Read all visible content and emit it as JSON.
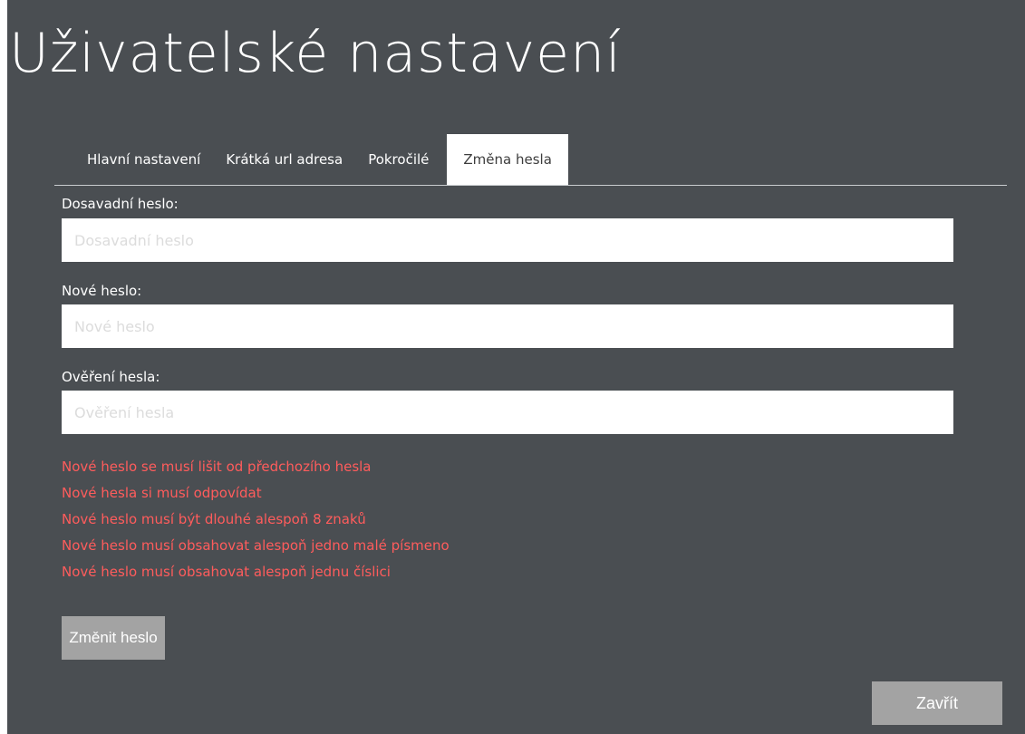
{
  "page": {
    "title": "Uživatelské nastavení"
  },
  "tabs": [
    {
      "label": "Hlavní nastavení",
      "active": false
    },
    {
      "label": "Krátká url adresa",
      "active": false
    },
    {
      "label": "Pokročilé",
      "active": false
    },
    {
      "label": "Změna hesla",
      "active": true
    }
  ],
  "form": {
    "current_password": {
      "label": "Dosavadní heslo:",
      "placeholder": "Dosavadní heslo",
      "value": ""
    },
    "new_password": {
      "label": "Nové heslo:",
      "placeholder": "Nové heslo",
      "value": ""
    },
    "confirm_password": {
      "label": "Ověření hesla:",
      "placeholder": "Ověření hesla",
      "value": ""
    }
  },
  "validation_errors": [
    "Nové heslo se musí lišit od předchozího hesla",
    "Nové hesla si musí odpovídat",
    "Nové heslo musí být dlouhé alespoň 8 znaků",
    "Nové heslo musí obsahovat alespoň jedno malé písmeno",
    "Nové heslo musí obsahovat alespoň jednu číslici"
  ],
  "buttons": {
    "change_password": "Změnit heslo",
    "close": "Zavřít"
  },
  "colors": {
    "panel_background": "#4a4e52",
    "error_text": "#ff5c5c",
    "button_background": "#a3a3a3",
    "active_tab_background": "#ffffff"
  }
}
